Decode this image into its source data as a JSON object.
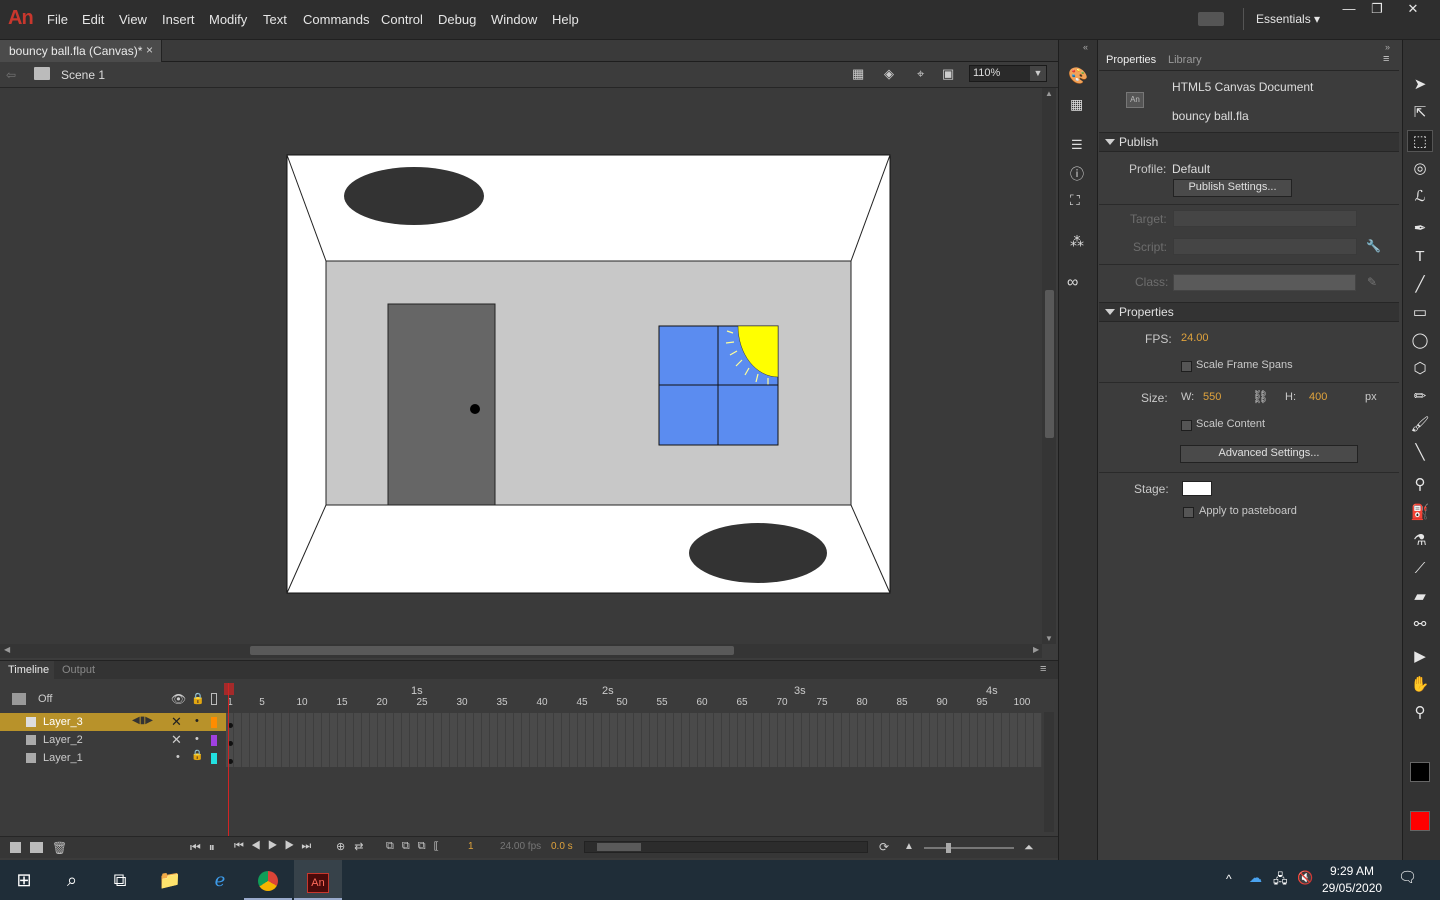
{
  "app": {
    "logo": "An"
  },
  "menu": [
    "File",
    "Edit",
    "View",
    "Insert",
    "Modify",
    "Text",
    "Commands",
    "Control",
    "Debug",
    "Window",
    "Help"
  ],
  "workspace": {
    "label": "Essentials",
    "caret": "▾"
  },
  "window_controls": {
    "minimize": "—",
    "restore": "❐",
    "close": "✕"
  },
  "document": {
    "tab_title": "bouncy ball.fla (Canvas)*",
    "tab_close": "×",
    "scene": "Scene 1",
    "zoom": "110%"
  },
  "stage_colors": {
    "room_bg": "#ffffff",
    "back_wall": "#c8c8c8",
    "door": "#666666",
    "window_glass": "#5b8cf0",
    "sun": "#ffff00",
    "shadow": "#333333"
  },
  "timeline": {
    "tabs": [
      "Timeline",
      "Output"
    ],
    "onion": "Off",
    "seconds": [
      "1s",
      "2s",
      "3s",
      "4s"
    ],
    "frame_numbers": [
      "1",
      "5",
      "10",
      "15",
      "20",
      "25",
      "30",
      "35",
      "40",
      "45",
      "50",
      "55",
      "60",
      "65",
      "70",
      "75",
      "80",
      "85",
      "90",
      "95",
      "100"
    ],
    "layers": [
      {
        "name": "Layer_3",
        "color": "#ff8c00",
        "selected": true
      },
      {
        "name": "Layer_2",
        "color": "#a040e0",
        "selected": false
      },
      {
        "name": "Layer_1",
        "color": "#22e0e0",
        "selected": false
      }
    ],
    "current_frame": "1",
    "fps_readout": "24.00 fps",
    "time_readout": "0.0 s"
  },
  "properties": {
    "tabs": [
      "Properties",
      "Library"
    ],
    "doc_type": "HTML5 Canvas Document",
    "doc_icon": "An",
    "file_name": "bouncy ball.fla",
    "publish": {
      "header": "Publish",
      "profile_label": "Profile:",
      "profile_value": "Default",
      "publish_settings": "Publish Settings...",
      "target_label": "Target:",
      "script_label": "Script:",
      "class_label": "Class:"
    },
    "props": {
      "header": "Properties",
      "fps_label": "FPS:",
      "fps_value": "24.00",
      "scale_frame_spans": "Scale Frame Spans",
      "size_label": "Size:",
      "w_label": "W:",
      "w_value": "550",
      "h_label": "H:",
      "h_value": "400",
      "unit": "px",
      "scale_content": "Scale Content",
      "advanced_settings": "Advanced Settings...",
      "stage_label": "Stage:",
      "stage_color": "#ffffff",
      "apply_to_pasteboard": "Apply to pasteboard"
    }
  },
  "toolbox": {
    "stroke_color": "#000000",
    "fill_color": "#ff0000",
    "tool_icons": [
      "selection-icon",
      "subselection-icon",
      "free-transform-icon",
      "3d-rotation-icon",
      "lasso-icon",
      "pen-icon",
      "text-icon",
      "line-icon",
      "rectangle-icon",
      "oval-icon",
      "polystar-icon",
      "pencil-icon",
      "paint-brush-icon",
      "brush-icon",
      "bone-icon",
      "paint-bucket-icon",
      "ink-bottle-icon",
      "eyedropper-icon",
      "eraser-icon",
      "width-icon",
      "camera-icon",
      "hand-icon",
      "zoom-icon"
    ]
  },
  "taskbar": {
    "time": "9:29 AM",
    "date": "29/05/2020"
  }
}
